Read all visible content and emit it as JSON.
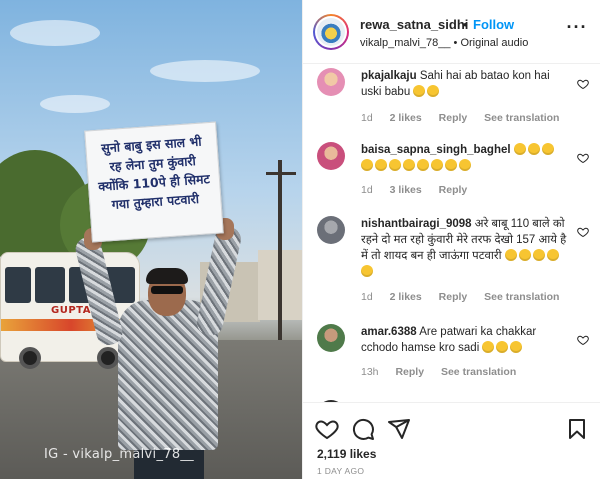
{
  "post": {
    "author": "rewa_satna_sidhi",
    "separator": "•",
    "follow_label": "Follow",
    "audio_line": "vikalp_malvi_78__ • Original audio",
    "more_label": "···"
  },
  "photo": {
    "placard_lines": [
      "सुनो बाबु इस साल भी",
      "रह लेना तुम कुंवारी",
      "क्योंकि 110पे ही सिमट",
      "गया तुम्हारा पटवारी"
    ],
    "bus_brand": "GUPTA",
    "watermark": "IG - vikalp_malvi_78__"
  },
  "comments": [
    {
      "username": "pkajalkaju",
      "text": "Sahi hai ab batao kon hai uski babu",
      "emoji_count": 2,
      "time": "1d",
      "likes": "2 likes",
      "reply": "Reply",
      "translation": "See translation",
      "avatar_color": "#e58fb4"
    },
    {
      "username": "baisa_sapna_singh_baghel",
      "text": "",
      "emoji_count": 11,
      "time": "1d",
      "likes": "3 likes",
      "reply": "Reply",
      "translation": "",
      "avatar_color": "#c94f7c"
    },
    {
      "username": "nishantbairagi_9098",
      "text": "अरे बाबू 110 बाले को रहने दो मत रहो कुंवारी मेरे तरफ देखो 157 आये है में तो शायद बन ही जाऊंगा पटवारी",
      "emoji_count": 5,
      "time": "1d",
      "likes": "2 likes",
      "reply": "Reply",
      "translation": "See translation",
      "avatar_color": "#6b6f78"
    },
    {
      "username": "amar.6388",
      "text": "Are patwari ka chakkar cchodo hamse kro sadi",
      "emoji_count": 3,
      "time": "13h",
      "likes": "",
      "reply": "Reply",
      "translation": "See translation",
      "avatar_color": "#4f7a4a"
    }
  ],
  "actions": {
    "like_icon": "heart-icon",
    "comment_icon": "comment-icon",
    "share_icon": "send-icon",
    "save_icon": "bookmark-icon"
  },
  "likes_text": "2,119 likes",
  "date_text": "1 DAY AGO"
}
